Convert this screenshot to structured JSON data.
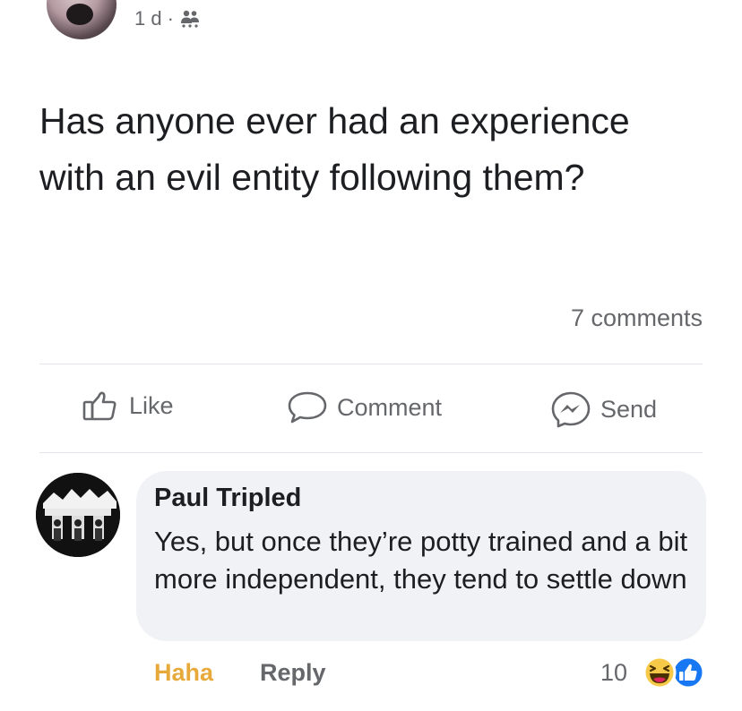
{
  "post": {
    "meta_time": "1 d",
    "meta_separator": "·",
    "audience_icon": "group-icon",
    "text": "Has anyone ever had an experience with an evil entity following them?",
    "comments_count": "7 comments"
  },
  "actions": {
    "like_label": "Like",
    "comment_label": "Comment",
    "send_label": "Send"
  },
  "comment": {
    "author": "Paul Tripled",
    "text": "Yes, but once they’re potty trained and a bit more independent, they tend to settle down",
    "reaction_label": "Haha",
    "reply_label": "Reply",
    "reaction_count": "10",
    "reaction_icons": [
      "haha-icon",
      "like-icon"
    ]
  },
  "colors": {
    "text": "#1c1e21",
    "muted": "#65676b",
    "bubble": "#f0f2f5",
    "haha": "#e8a93b",
    "like_blue": "#1877f2"
  }
}
